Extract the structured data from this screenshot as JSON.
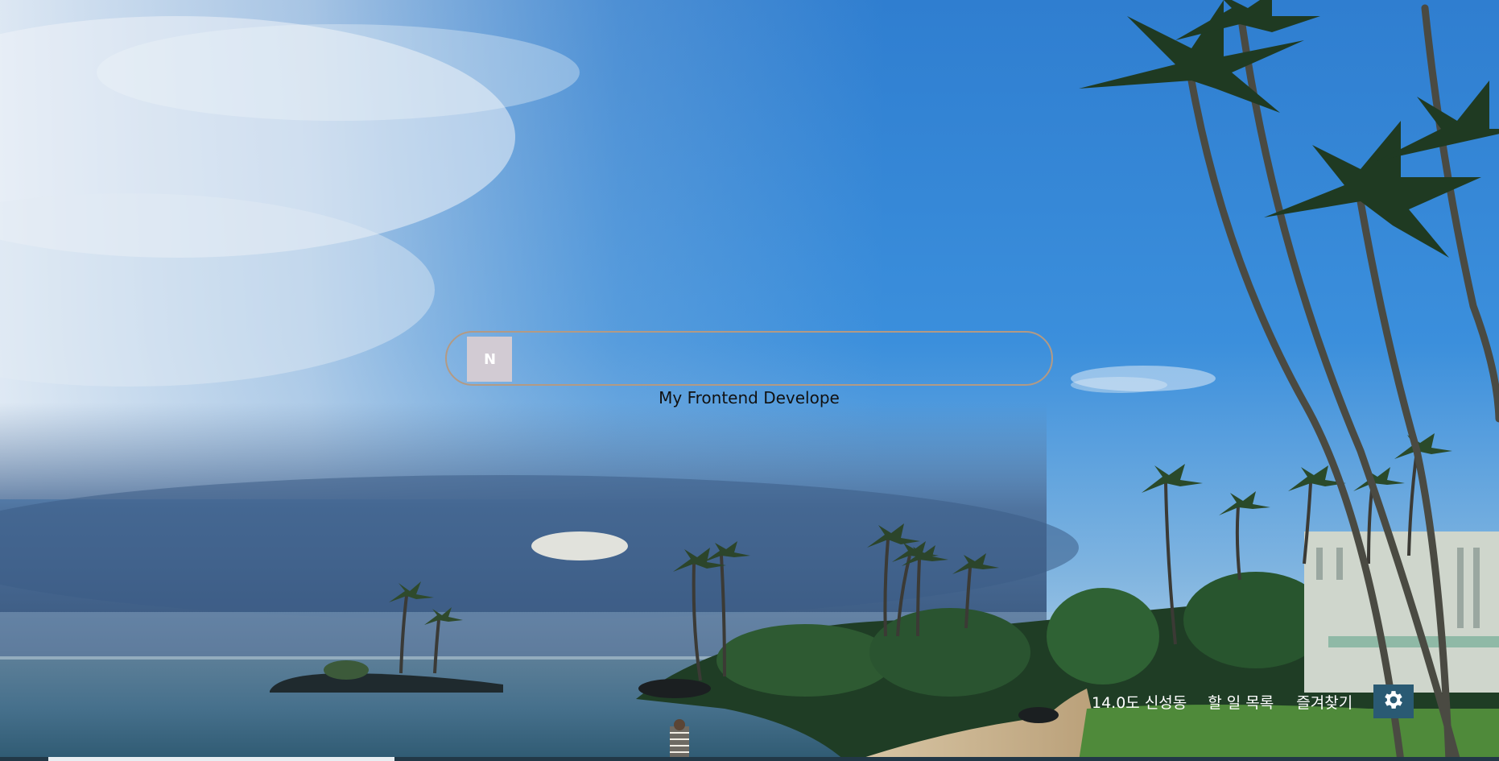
{
  "colors": {
    "search_border": "#b39a84",
    "logo_bg": "#d2cbd3",
    "settings_bg": "#2a5a73",
    "tagline_text": "#111111",
    "overlay_text": "#ffffff"
  },
  "search": {
    "logo_letter": "N",
    "placeholder": "",
    "value": ""
  },
  "tagline": "My Frontend Develope",
  "weather": {
    "text": "14.0도 신성동"
  },
  "links": {
    "todo": "할 일 목록",
    "bookmarks": "즐겨찾기"
  },
  "settings": {
    "icon": "gear-icon"
  }
}
